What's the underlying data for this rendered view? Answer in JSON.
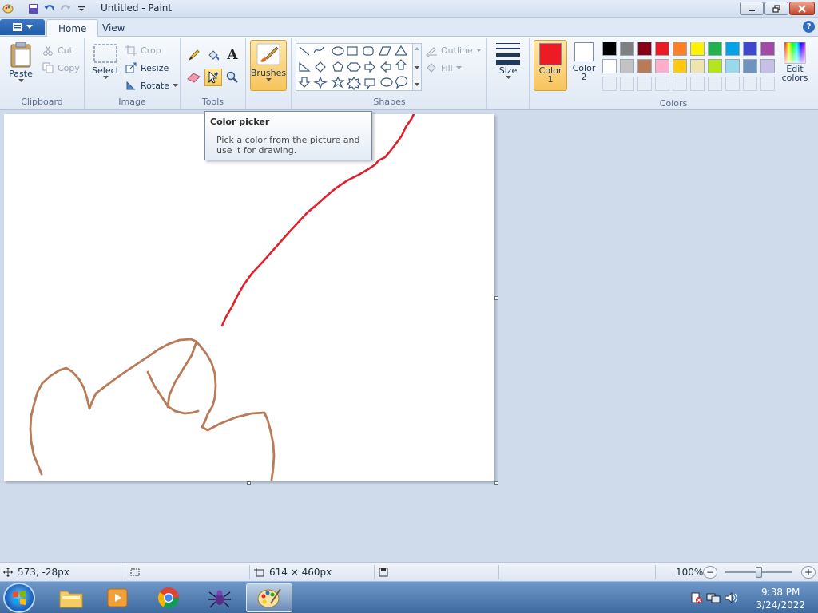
{
  "window": {
    "title": "Untitled - Paint"
  },
  "ribbon_tabs": {
    "home": "Home",
    "view": "View"
  },
  "clipboard": {
    "paste": "Paste",
    "cut": "Cut",
    "copy": "Copy",
    "label": "Clipboard"
  },
  "image": {
    "select": "Select",
    "crop": "Crop",
    "resize": "Resize",
    "rotate": "Rotate",
    "label": "Image"
  },
  "tools": {
    "label": "Tools",
    "text_glyph": "A"
  },
  "brushes": {
    "label": "Brushes"
  },
  "shapes": {
    "outline": "Outline",
    "fill": "Fill",
    "label": "Shapes"
  },
  "size": {
    "label": "Size"
  },
  "colors": {
    "color1_label": "Color",
    "color1_index": "1",
    "color2_label": "Color",
    "color2_index": "2",
    "edit_label": "Edit",
    "edit_label2": "colors",
    "label": "Colors",
    "color1": "#ed1c24",
    "color2": "#ffffff",
    "palette_row1": [
      "#000000",
      "#7f7f7f",
      "#880015",
      "#ed1c24",
      "#ff7f27",
      "#fff200",
      "#22b14c",
      "#00a2e8",
      "#3f48cc",
      "#a349a4"
    ],
    "palette_row2": [
      "#ffffff",
      "#c3c3c3",
      "#b97a57",
      "#ffaec9",
      "#ffc90e",
      "#efe4b0",
      "#b5e61d",
      "#99d9ea",
      "#7092be",
      "#c8bfe7"
    ]
  },
  "tooltip": {
    "title": "Color picker",
    "body_line1": "Pick a color from the picture and",
    "body_line2": "use it for drawing."
  },
  "statusbar": {
    "cursor_pos": "573, -28px",
    "canvas_size": "614 × 460px",
    "zoom": "100%",
    "zoom_minus": "−",
    "zoom_plus": "+"
  },
  "taskbar": {
    "time": "9:38 PM",
    "date": "3/24/2022"
  },
  "drawing": {
    "red_stroke_color": "#e0202a",
    "brown_stroke_color": "#b97a57"
  }
}
